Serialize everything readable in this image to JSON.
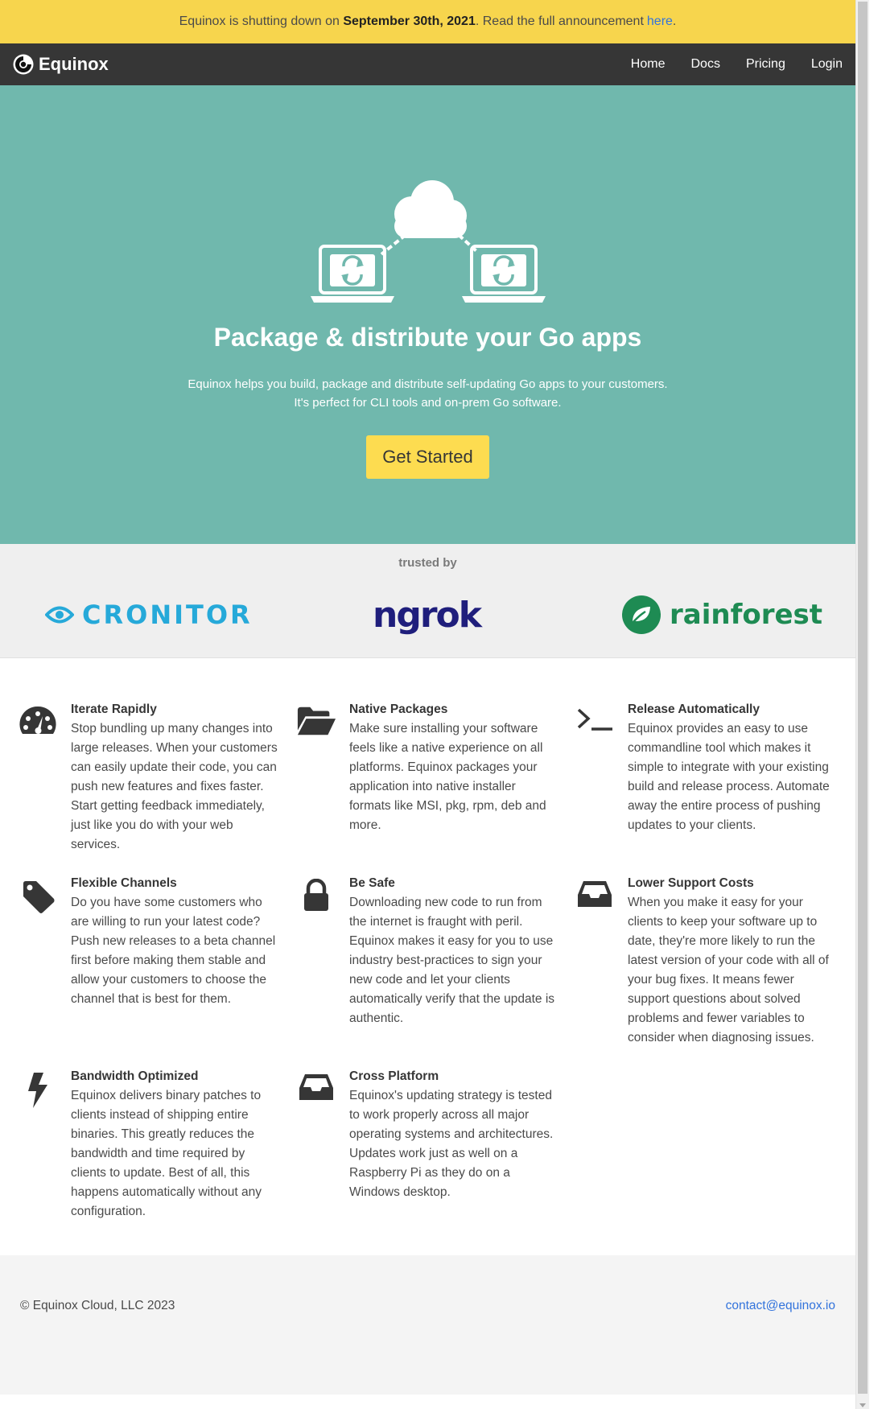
{
  "announcement": {
    "prefix": "Equinox is shutting down on",
    "date": "September 30th, 2021",
    "middle": ". Read the full announcement",
    "link": "here",
    "suffix": "."
  },
  "nav": {
    "brand": "Equinox",
    "items": [
      "Home",
      "Docs",
      "Pricing",
      "Login"
    ]
  },
  "hero": {
    "title": "Package & distribute your Go apps",
    "subtitle_line1": "Equinox helps you build, package and distribute self-updating Go apps to your customers.",
    "subtitle_line2": "It's perfect for CLI tools and on-prem Go software.",
    "cta": "Get Started",
    "illustration_icon": "cloud-laptops-sync-icon"
  },
  "trusted": {
    "label": "trusted by",
    "logos": [
      "CRONITOR",
      "ngrok",
      "rainforest"
    ]
  },
  "features": [
    {
      "icon": "dashboard-gauge-icon",
      "title": "Iterate Rapidly",
      "text": "Stop bundling up many changes into large releases. When your customers can easily update their code, you can push new features and fixes faster. Start getting feedback immediately, just like you do with your web services."
    },
    {
      "icon": "folder-open-icon",
      "title": "Native Packages",
      "text": "Make sure installing your software feels like a native experience on all platforms. Equinox packages your application into native installer formats like MSI, pkg, rpm, deb and more."
    },
    {
      "icon": "terminal-icon",
      "title": "Release Automatically",
      "text": "Equinox provides an easy to use commandline tool which makes it simple to integrate with your existing build and release process. Automate away the entire process of pushing updates to your clients."
    },
    {
      "icon": "tag-icon",
      "title": "Flexible Channels",
      "text": "Do you have some customers who are willing to run your latest code? Push new releases to a beta channel first before making them stable and allow your customers to choose the channel that is best for them."
    },
    {
      "icon": "lock-icon",
      "title": "Be Safe",
      "text": "Downloading new code to run from the internet is fraught with peril. Equinox makes it easy for you to use industry best-practices to sign your new code and let your clients automatically verify that the update is authentic."
    },
    {
      "icon": "inbox-icon",
      "title": "Lower Support Costs",
      "text": "When you make it easy for your clients to keep your software up to date, they're more likely to run the latest version of your code with all of your bug fixes. It means fewer support questions about solved problems and fewer variables to consider when diagnosing issues."
    },
    {
      "icon": "bolt-icon",
      "title": "Bandwidth Optimized",
      "text": "Equinox delivers binary patches to clients instead of shipping entire binaries. This greatly reduces the bandwidth and time required by clients to update. Best of all, this happens automatically without any configuration."
    },
    {
      "icon": "inbox-icon",
      "title": "Cross Platform",
      "text": "Equinox's updating strategy is tested to work properly across all major operating systems and architectures. Updates work just as well on a Raspberry Pi as they do on a Windows desktop."
    }
  ],
  "footer": {
    "copyright": "© Equinox Cloud, LLC 2023",
    "contact": "contact@equinox.io"
  },
  "colors": {
    "announcement_bg": "#f7d54d",
    "navbar_bg": "#363636",
    "hero_bg": "#70b8ad",
    "cta_bg": "#fddc50",
    "cronitor": "#26a9d9",
    "ngrok": "#1f1e7c",
    "rainforest": "#1e8b53",
    "link": "#3273dc"
  }
}
